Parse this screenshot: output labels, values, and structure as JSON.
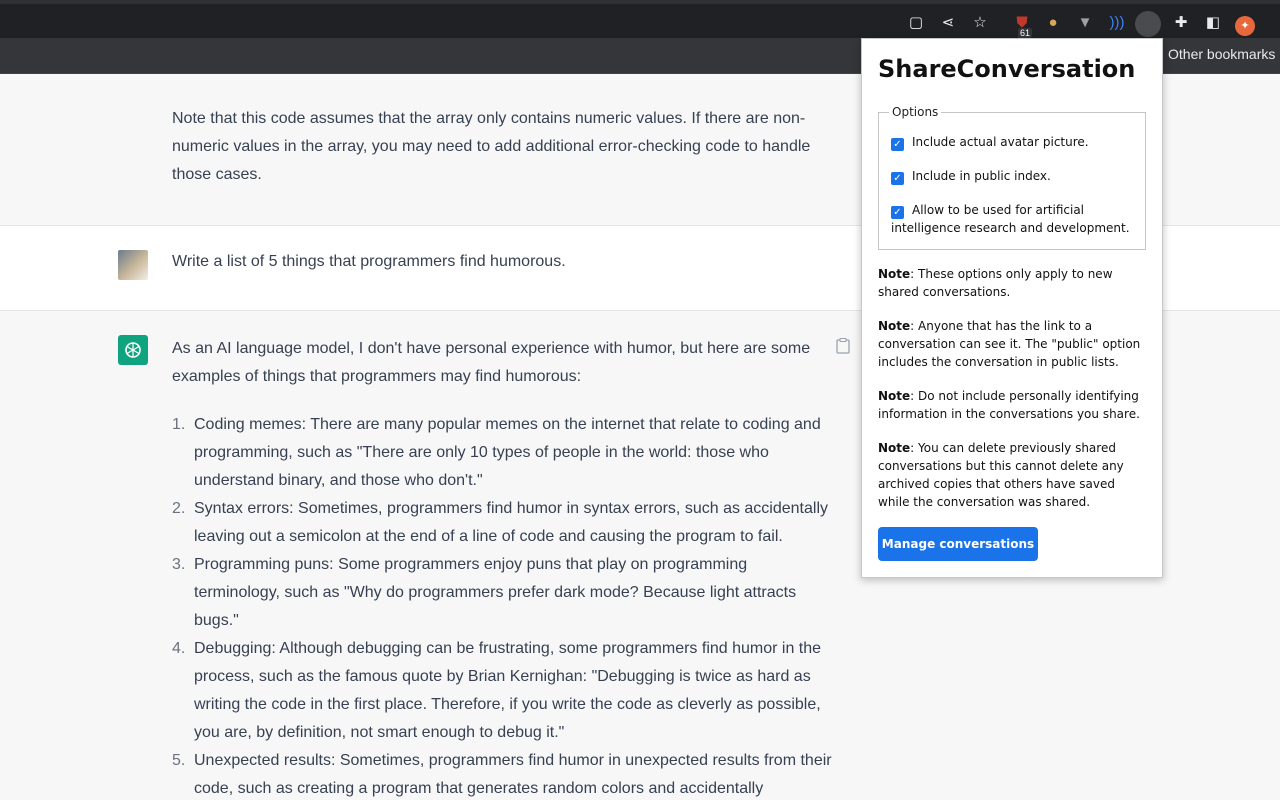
{
  "browser": {
    "toolbar_icons": [
      "clipboard-icon",
      "share-icon",
      "star-icon",
      "ublock-icon",
      "cookie-icon",
      "vuejs-icon",
      "wave-icon",
      "shareconversation-icon",
      "puzzle-icon",
      "sidepanel-icon"
    ],
    "extension_badge": "61",
    "bookmarks_other": "Other bookmarks"
  },
  "chat": {
    "prev_answer_tail": "Note that this code assumes that the array only contains numeric values. If there are non-numeric values in the array, you may need to add additional error-checking code to handle those cases.",
    "user_prompt": "Write a list of 5 things that programmers find humorous.",
    "assistant_intro": "As an AI language model, I don't have personal experience with humor, but here are some examples of things that programmers may find humorous:",
    "list": [
      {
        "num": "1.",
        "text": "Coding memes: There are many popular memes on the internet that relate to coding and programming, such as \"There are only 10 types of people in the world: those who understand binary, and those who don't.\""
      },
      {
        "num": "2.",
        "text": "Syntax errors: Sometimes, programmers find humor in syntax errors, such as accidentally leaving out a semicolon at the end of a line of code and causing the program to fail."
      },
      {
        "num": "3.",
        "text": "Programming puns: Some programmers enjoy puns that play on programming terminology, such as \"Why do programmers prefer dark mode? Because light attracts bugs.\""
      },
      {
        "num": "4.",
        "text": "Debugging: Although debugging can be frustrating, some programmers find humor in the process, such as the famous quote by Brian Kernighan: \"Debugging is twice as hard as writing the code in the first place. Therefore, if you write the code as cleverly as possible, you are, by definition, not smart enough to debug it.\""
      },
      {
        "num": "5.",
        "text": "Unexpected results: Sometimes, programmers find humor in unexpected results from their code, such as creating a program that generates random colors and accidentally"
      }
    ]
  },
  "popup": {
    "title": "ShareConversation",
    "options_legend": "Options",
    "options": [
      {
        "label": "Include actual avatar picture.",
        "checked": true
      },
      {
        "label": "Include in public index.",
        "checked": true
      },
      {
        "label": "Allow to be used for artificial intelligence research and development.",
        "checked": true
      }
    ],
    "notes": [
      {
        "bold": "Note",
        "text": ": These options only apply to new shared conversations."
      },
      {
        "bold": "Note",
        "text": ": Anyone that has the link to a conversation can see it. The \"public\" option includes the conversation in public lists."
      },
      {
        "bold": "Note",
        "text": ": Do not include personally identifying information in the conversations you share."
      },
      {
        "bold": "Note",
        "text": ": You can delete previously shared conversations but this cannot delete any archived copies that others have saved while the conversation was shared."
      }
    ],
    "manage_button": "Manage conversations",
    "accent": "#1a73e8"
  }
}
